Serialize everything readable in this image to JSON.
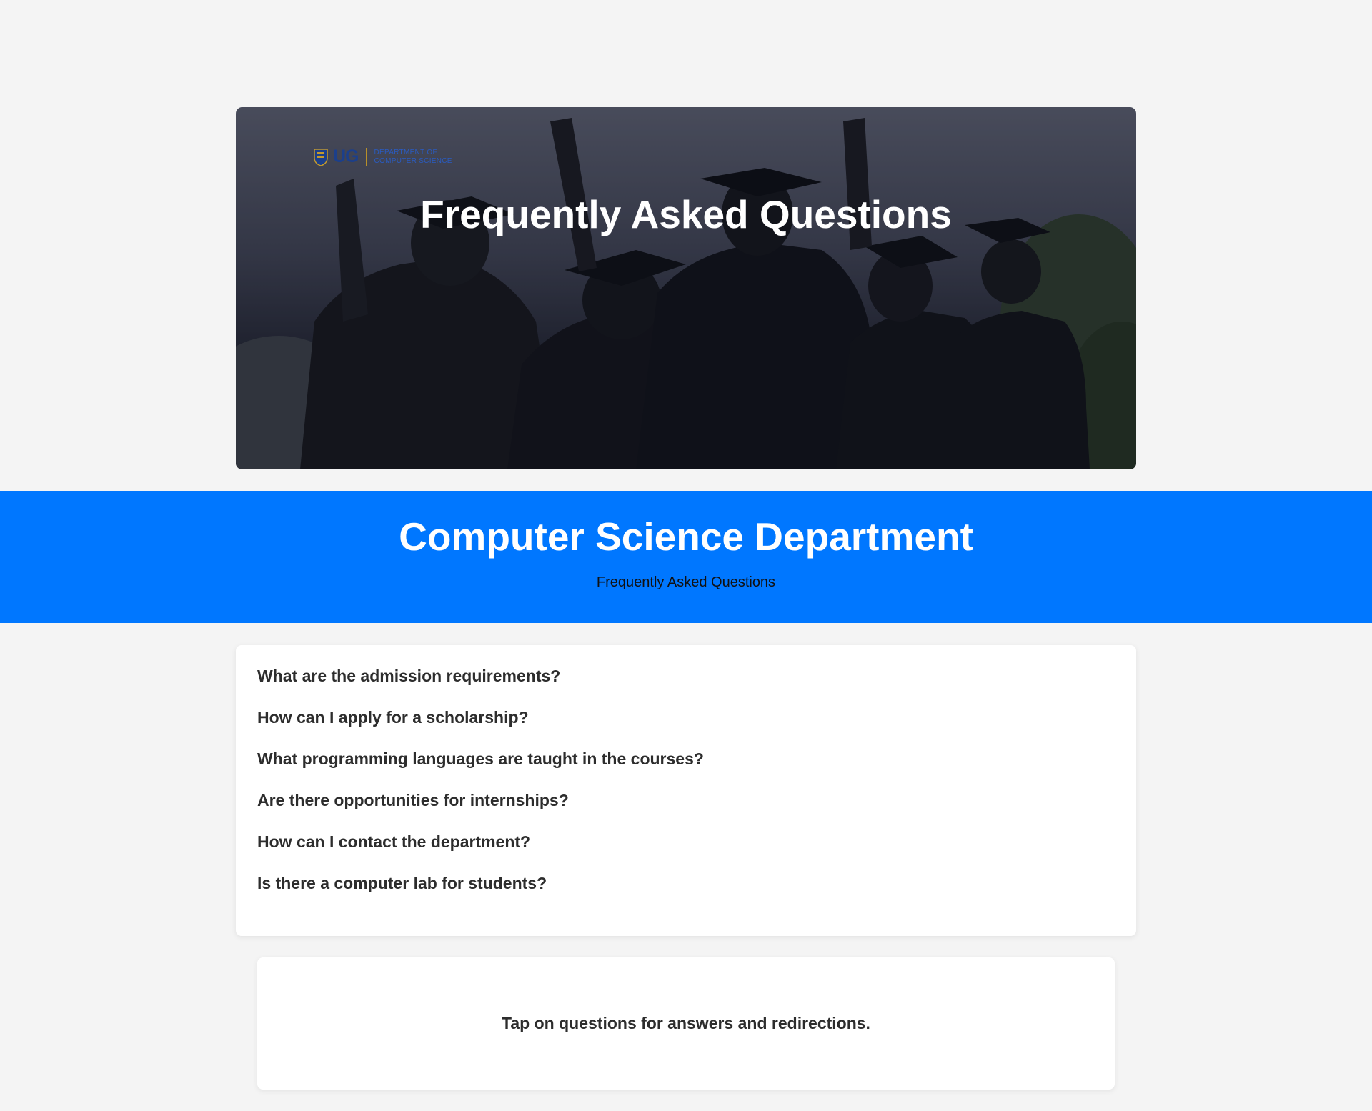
{
  "hero": {
    "title": "Frequently Asked Questions",
    "logo": {
      "short": "UG",
      "dept_line1": "Department of",
      "dept_line2": "Computer Science"
    }
  },
  "department": {
    "title": "Computer Science Department",
    "subtitle": "Frequently Asked Questions"
  },
  "faq": {
    "questions": [
      "What are the admission requirements?",
      "How can I apply for a scholarship?",
      "What programming languages are taught in the courses?",
      "Are there opportunities for internships?",
      "How can I contact the department?",
      "Is there a computer lab for students?"
    ]
  },
  "tip": {
    "text": "Tap on questions for answers and redirections."
  },
  "colors": {
    "band": "#0077ff",
    "page_bg": "#f4f4f4",
    "card_bg": "#ffffff"
  }
}
